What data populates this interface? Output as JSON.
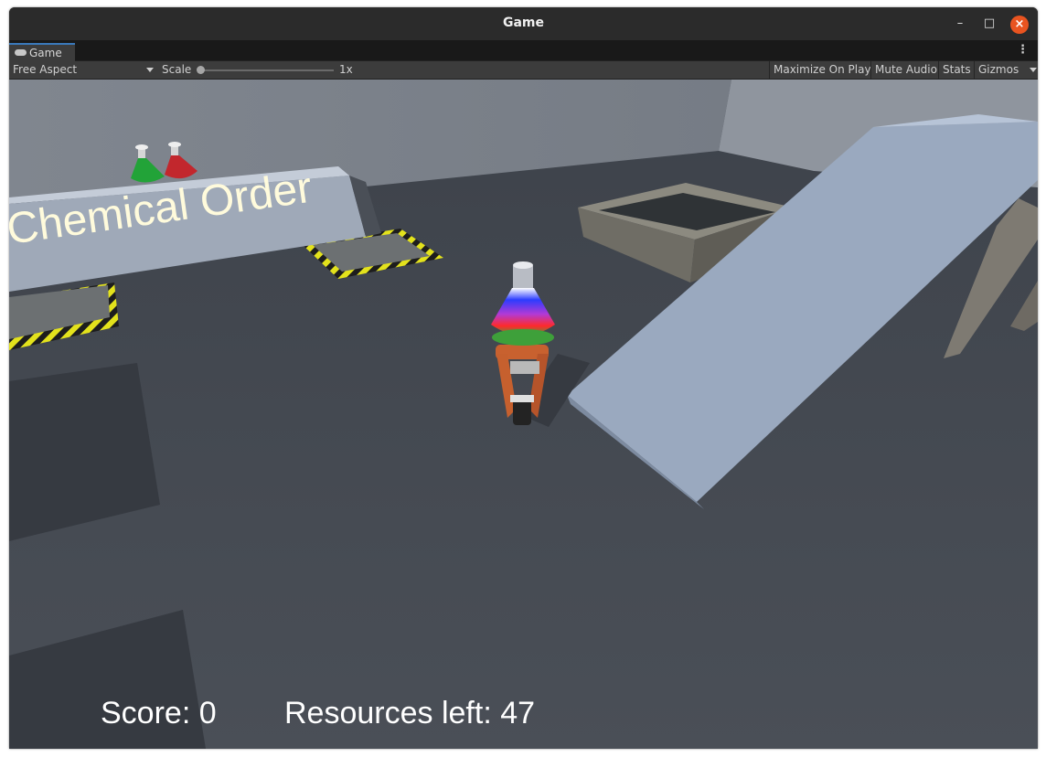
{
  "window": {
    "title": "Game",
    "minimize_glyph": "–",
    "maximize_glyph": "□",
    "close_glyph": "×"
  },
  "tab": {
    "label": "Game",
    "icon": "gamepad-icon"
  },
  "toolbar": {
    "aspect": "Free Aspect",
    "scale_label": "Scale",
    "scale_value": "1x",
    "scale_slider_level": 0.0,
    "maximize_on_play": "Maximize On Play",
    "mute_audio": "Mute Audio",
    "stats": "Stats",
    "gizmos": "Gizmos"
  },
  "scene": {
    "sign_text": "Chemical Order",
    "colors": {
      "floor": "#41464e",
      "wall": "#7b818b",
      "ramp": "#9aa9bf",
      "sign_text": "#fffbdc",
      "hazard_yellow": "#e6e61e",
      "flask_green": "#22a338",
      "flask_red": "#c2272d"
    }
  },
  "hud": {
    "score": "Score: 0",
    "resources_left": "Resources left: 47"
  }
}
